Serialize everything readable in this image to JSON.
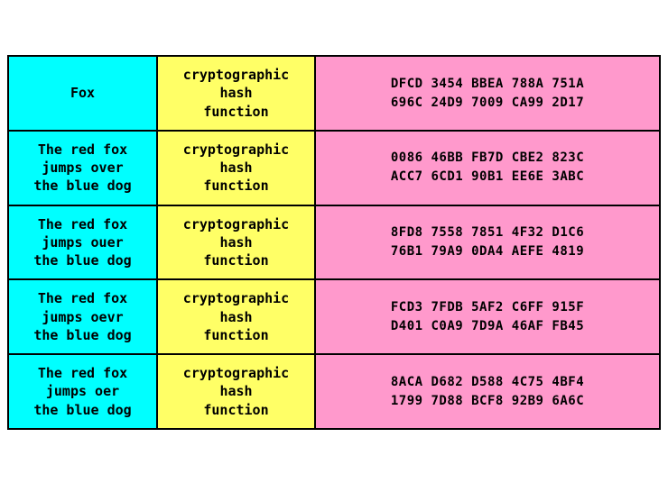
{
  "rows": [
    {
      "input": "Fox",
      "fn": "cryptographic\nhash\nfunction",
      "hash": "DFCD 3454 BBEA 788A 751A\n696C 24D9 7009 CA99 2D17"
    },
    {
      "input": "The red fox\njumps over\nthe blue dog",
      "fn": "cryptographic\nhash\nfunction",
      "hash": "0086 46BB FB7D CBE2 823C\nACC7 6CD1 90B1 EE6E 3ABC"
    },
    {
      "input": "The red fox\njumps ouer\nthe blue dog",
      "fn": "cryptographic\nhash\nfunction",
      "hash": "8FD8 7558 7851 4F32 D1C6\n76B1 79A9 0DA4 AEFE 4819"
    },
    {
      "input": "The red fox\njumps oevr\nthe blue dog",
      "fn": "cryptographic\nhash\nfunction",
      "hash": "FCD3 7FDB 5AF2 C6FF 915F\nD401 C0A9 7D9A 46AF FB45"
    },
    {
      "input": "The red fox\njumps oer\nthe blue dog",
      "fn": "cryptographic\nhash\nfunction",
      "hash": "8ACA D682 D588 4C75 4BF4\n1799 7D88 BCF8 92B9 6A6C"
    }
  ]
}
